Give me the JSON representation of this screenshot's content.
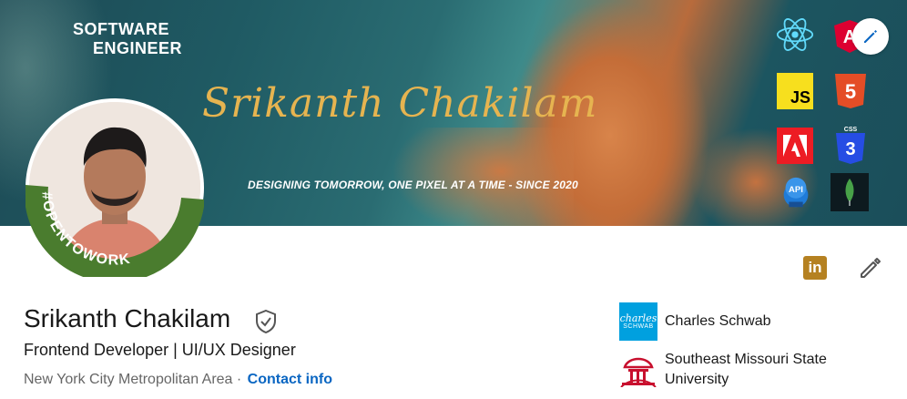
{
  "banner": {
    "role_line1": "SOFTWARE",
    "role_line2": "ENGINEER",
    "signature": "Srikanth Chakilam",
    "tagline": "DESIGNING TOMORROW, ONE PIXEL AT A TIME - SINCE 2020",
    "tech_icons": [
      "react-icon",
      "angular-icon",
      "js-icon",
      "html5-icon",
      "adobe-icon",
      "css3-icon",
      "api-icon",
      "mongodb-icon"
    ],
    "js_label": "JS",
    "html_label": "5",
    "css_label": "3",
    "css_small": "CSS",
    "api_label": "API",
    "angular_label": "A"
  },
  "avatar": {
    "badge": "#OPENTOWORK"
  },
  "profile": {
    "name": "Srikanth Chakilam",
    "headline": "Frontend Developer | UI/UX Designer",
    "location": "New York City Metropolitan Area",
    "separator": " · ",
    "contact_label": "Contact info"
  },
  "actions": {
    "linkedin_label": "in"
  },
  "experience": [
    {
      "name": "Charles Schwab",
      "logo_text_1": "charles",
      "logo_text_2": "SCHWAB"
    },
    {
      "name_line1": "Southeast Missouri State",
      "name_line2": "University"
    }
  ],
  "colors": {
    "accent_blue": "#0a66c2",
    "signature_gold": "#e6b450",
    "opentowork_green": "#4a7c2e",
    "schwab_blue": "#00a0df",
    "semo_red": "#c8102e"
  }
}
